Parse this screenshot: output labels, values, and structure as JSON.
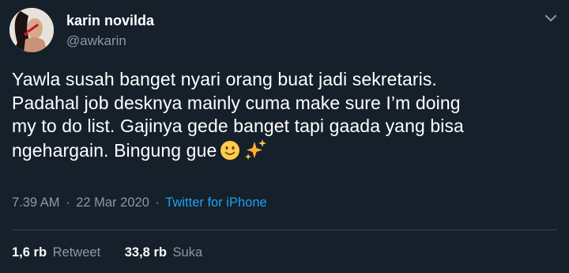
{
  "user": {
    "name": "karin novilda",
    "handle": "@awkarin"
  },
  "tweet": {
    "lines": [
      "Yawla susah banget nyari orang buat jadi sekretaris.",
      "Padahal job desknya mainly cuma make sure I’m doing",
      "my to do list. Gajinya gede banget tapi gaada yang bisa",
      "ngehargain. Bingung gue"
    ],
    "emojis": [
      "slightly-smiling-face-icon",
      "sparkles-icon"
    ]
  },
  "meta": {
    "time": "7.39 AM",
    "separator": "·",
    "date": "22 Mar 2020",
    "source": "Twitter for iPhone"
  },
  "stats": {
    "retweets_count": "1,6 rb",
    "retweets_label": "Retweet",
    "likes_count": "33,8 rb",
    "likes_label": "Suka"
  },
  "icons": {
    "caret": "chevron-down-icon"
  },
  "colors": {
    "background": "#15202b",
    "primary_text": "#ffffff",
    "secondary_text": "#8899a6",
    "link": "#1da1f2",
    "divider": "#38444d"
  }
}
